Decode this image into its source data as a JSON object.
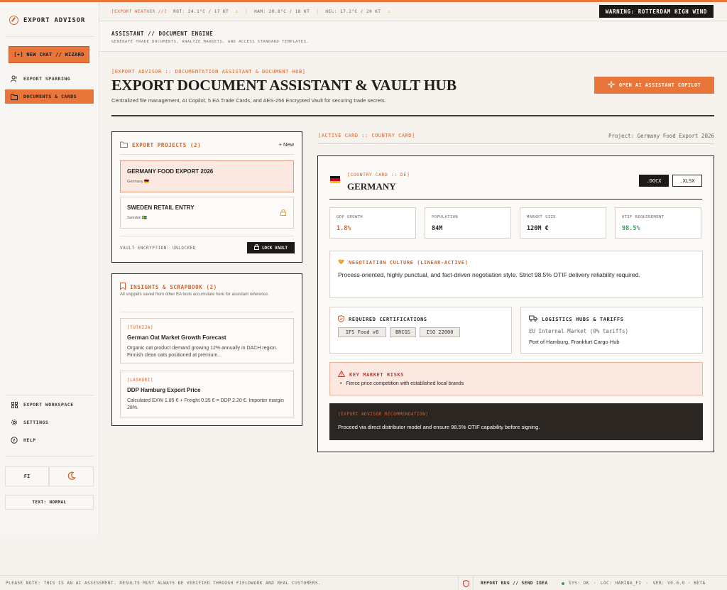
{
  "brand": {
    "name": "EXPORT ADVISOR"
  },
  "sidebar": {
    "new_chat": "[+] NEW CHAT // WIZARD",
    "nav": [
      {
        "label": "EXPORT SPARRING"
      },
      {
        "label": "DOCUMENTS & CARDS"
      }
    ],
    "bottom_nav": [
      {
        "label": "EXPORT WORKSPACE"
      },
      {
        "label": "SETTINGS"
      },
      {
        "label": "HELP"
      }
    ],
    "lang": "FI",
    "text_size": "TEXT: NORMAL"
  },
  "weather": {
    "label": "[EXPORT WEATHER //]",
    "items": [
      "ROT: 24.1°C / 17 KT",
      "HAM: 20.8°C / 18 KT",
      "HEL: 17.2°C / 20 KT"
    ],
    "sep": "|",
    "warning": "WARNING: ROTTERDAM HIGH WIND"
  },
  "header": {
    "title": "ASSISTANT // DOCUMENT ENGINE",
    "subtitle": "GENERATE TRADE DOCUMENTS, ANALYZE MARKETS, AND ACCESS STANDARD TEMPLATES."
  },
  "hero": {
    "tag": "[EXPORT ADVISOR :: DOCUMENTATION ASSISTANT & DOCUMENT HUB]",
    "title": "EXPORT DOCUMENT ASSISTANT & VAULT HUB",
    "desc": "Centralized file management, AI Copilot, 5 EA Trade Cards, and AES-256 Encrypted Vault for securing trade secrets.",
    "copilot_btn": "OPEN AI ASSISTANT COPILOT"
  },
  "projects": {
    "title": "EXPORT PROJECTS (2)",
    "new_btn": "+ New",
    "items": [
      {
        "name": "GERMANY FOOD EXPORT 2026",
        "country": "Germany 🇩🇪"
      },
      {
        "name": "SWEDEN RETAIL ENTRY",
        "country": "Sweden 🇸🇪"
      }
    ],
    "vault_status": "VAULT ENCRYPTION: UNLOCKED",
    "vault_btn": "LOCK VAULT"
  },
  "insights": {
    "title": "INSIGHTS & SCRAPBOOK (2)",
    "desc": "All snippets saved from other EA tools accumulate here for assistant reference.",
    "items": [
      {
        "tag": "[TUTKIJA]",
        "title": "German Oat Market Growth Forecast",
        "body": "Organic oat product demand growing 12% annually in DACH region. Finnish clean oats positioned at premium..."
      },
      {
        "tag": "[LASKURI]",
        "title": "DDP Hamburg Export Price",
        "body": "Calculated EXW 1.85 € + Freight 0.35 € = DDP 2.20 €. Importer margin 28%."
      }
    ]
  },
  "active": {
    "label": "[ACTIVE CARD :: COUNTRY CARD]",
    "project": "Project: Germany Food Export 2026"
  },
  "country": {
    "tag": "[COUNTRY CARD :: DE]",
    "name": "GERMANY",
    "docx": ".DOCX",
    "xlsx": ".XLSX",
    "stats": [
      {
        "label": "GDP GROWTH",
        "value": "1.8%"
      },
      {
        "label": "POPULATION",
        "value": "84M"
      },
      {
        "label": "MARKET SIZE",
        "value": "120M €"
      },
      {
        "label": "OTIF REQUIREMENT",
        "value": "98.5%"
      }
    ],
    "culture_title": "NEGOTIATION CULTURE (LINEAR-ACTIVE)",
    "culture_text": "Process-oriented, highly punctual, and fact-driven negotiation style. Strict 98.5% OTIF delivery reliability required.",
    "cert_title": "REQUIRED CERTIFICATIONS",
    "certs": [
      "IFS Food v8",
      "BRCGS",
      "ISO 22000"
    ],
    "logistics_title": "LOGISTICS HUBS & TARIFFS",
    "logistics_market": "EU Internal Market (0% tariffs)",
    "logistics_hubs": "Port of Hamburg, Frankfurt Cargo Hub",
    "risk_title": "KEY MARKET RISKS",
    "risks": [
      "Fierce price competition with established local brands"
    ],
    "reco_tag": "[EXPORT ADVISOR RECOMMENDATION]",
    "reco_text": "Proceed via direct distributor model and ensure 98.5% OTIF capability before signing."
  },
  "footer": {
    "note": "PLEASE NOTE: THIS IS AN AI ASSESSMENT. RESULTS MUST ALWAYS BE VERIFIED THROUGH FIELDWORK AND REAL CUSTOMERS.",
    "bug": "REPORT BUG // SEND IDEA",
    "sys": "SYS: OK",
    "loc": "LOC: HAMINA_FI",
    "ver": "VER: V0.6.0 · BETA",
    "dot": "·"
  },
  "colors": {
    "accent": "#e8753a",
    "dark": "#1d1915",
    "green": "#3aa060",
    "red": "#d4622d"
  }
}
